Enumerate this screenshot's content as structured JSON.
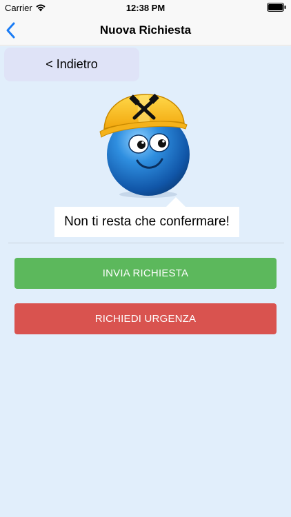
{
  "status_bar": {
    "carrier": "Carrier",
    "time": "12:38 PM",
    "icons": [
      "wifi-icon",
      "battery-icon"
    ]
  },
  "nav": {
    "title": "Nuova Richiesta",
    "back_icon": "chevron-left-icon"
  },
  "content": {
    "back_button_label": "< Indietro",
    "mascot": "blue-ball-construction-helmet-mascot",
    "speech_bubble_text": "Non ti resta che confermare!",
    "send_button_label": "INVIA RICHIESTA",
    "urgent_button_label": "RICHIEDI URGENZA"
  },
  "colors": {
    "accent_blue": "#1a7cf5",
    "send_green": "#5cb85c",
    "urgent_red": "#d9534f",
    "background": "#e1eefb"
  }
}
